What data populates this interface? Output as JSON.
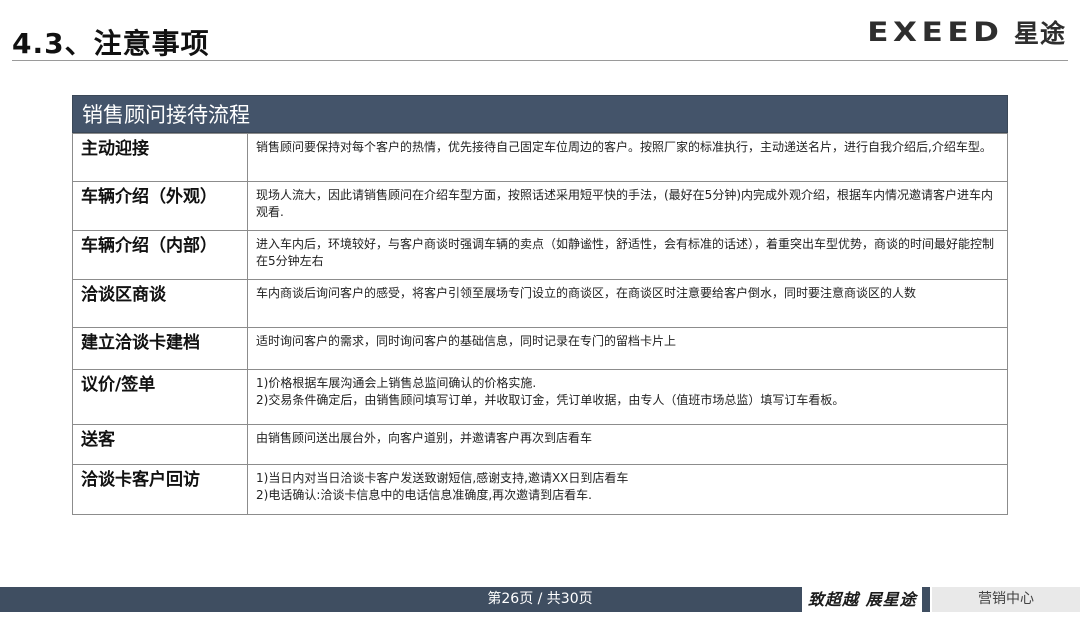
{
  "header": {
    "title": "4.3、注意事项",
    "brand_logo": "EXEED",
    "brand_cn": "星途"
  },
  "table": {
    "title": "销售顾问接待流程",
    "rows": [
      {
        "step": "主动迎接",
        "desc": "销售顾问要保持对每个客户的热情，优先接待自己固定车位周边的客户。按照厂家的标准执行，主动递送名片，进行自我介绍后,介绍车型。"
      },
      {
        "step": "车辆介绍（外观）",
        "desc": "现场人流大，因此请销售顾问在介绍车型方面，按照话述采用短平快的手法，(最好在5分钟)内完成外观介绍，根据车内情况邀请客户进车内观看."
      },
      {
        "step": "车辆介绍（内部）",
        "desc": "进入车内后，环境较好，与客户商谈时强调车辆的卖点（如静谧性，舒适性，会有标准的话述），着重突出车型优势，商谈的时间最好能控制在5分钟左右"
      },
      {
        "step": "洽谈区商谈",
        "desc": "车内商谈后询问客户的感受，将客户引领至展场专门设立的商谈区，在商谈区时注意要给客户倒水，同时要注意商谈区的人数"
      },
      {
        "step": "建立洽谈卡建档",
        "desc": "适时询问客户的需求，同时询问客户的基础信息，同时记录在专门的留档卡片上"
      },
      {
        "step": "议价/签单",
        "desc": "1)价格根据车展沟通会上销售总监间确认的价格实施.\n2)交易条件确定后，由销售顾问填写订单，并收取订金，凭订单收据，由专人（值班市场总监）填写订车看板。"
      },
      {
        "step": "送客",
        "desc": "由销售顾问送出展台外，向客户道别，并邀请客户再次到店看车"
      },
      {
        "step": "洽谈卡客户回访",
        "desc": "1)当日内对当日洽谈卡客户发送致谢短信,感谢支持,邀请XX日到店看车\n2)电话确认:洽谈卡信息中的电话信息准确度,再次邀请到店看车."
      }
    ]
  },
  "footer": {
    "page": "第26页 / 共30页",
    "slogan": "致超越 展星途",
    "dept": "营销中心"
  }
}
